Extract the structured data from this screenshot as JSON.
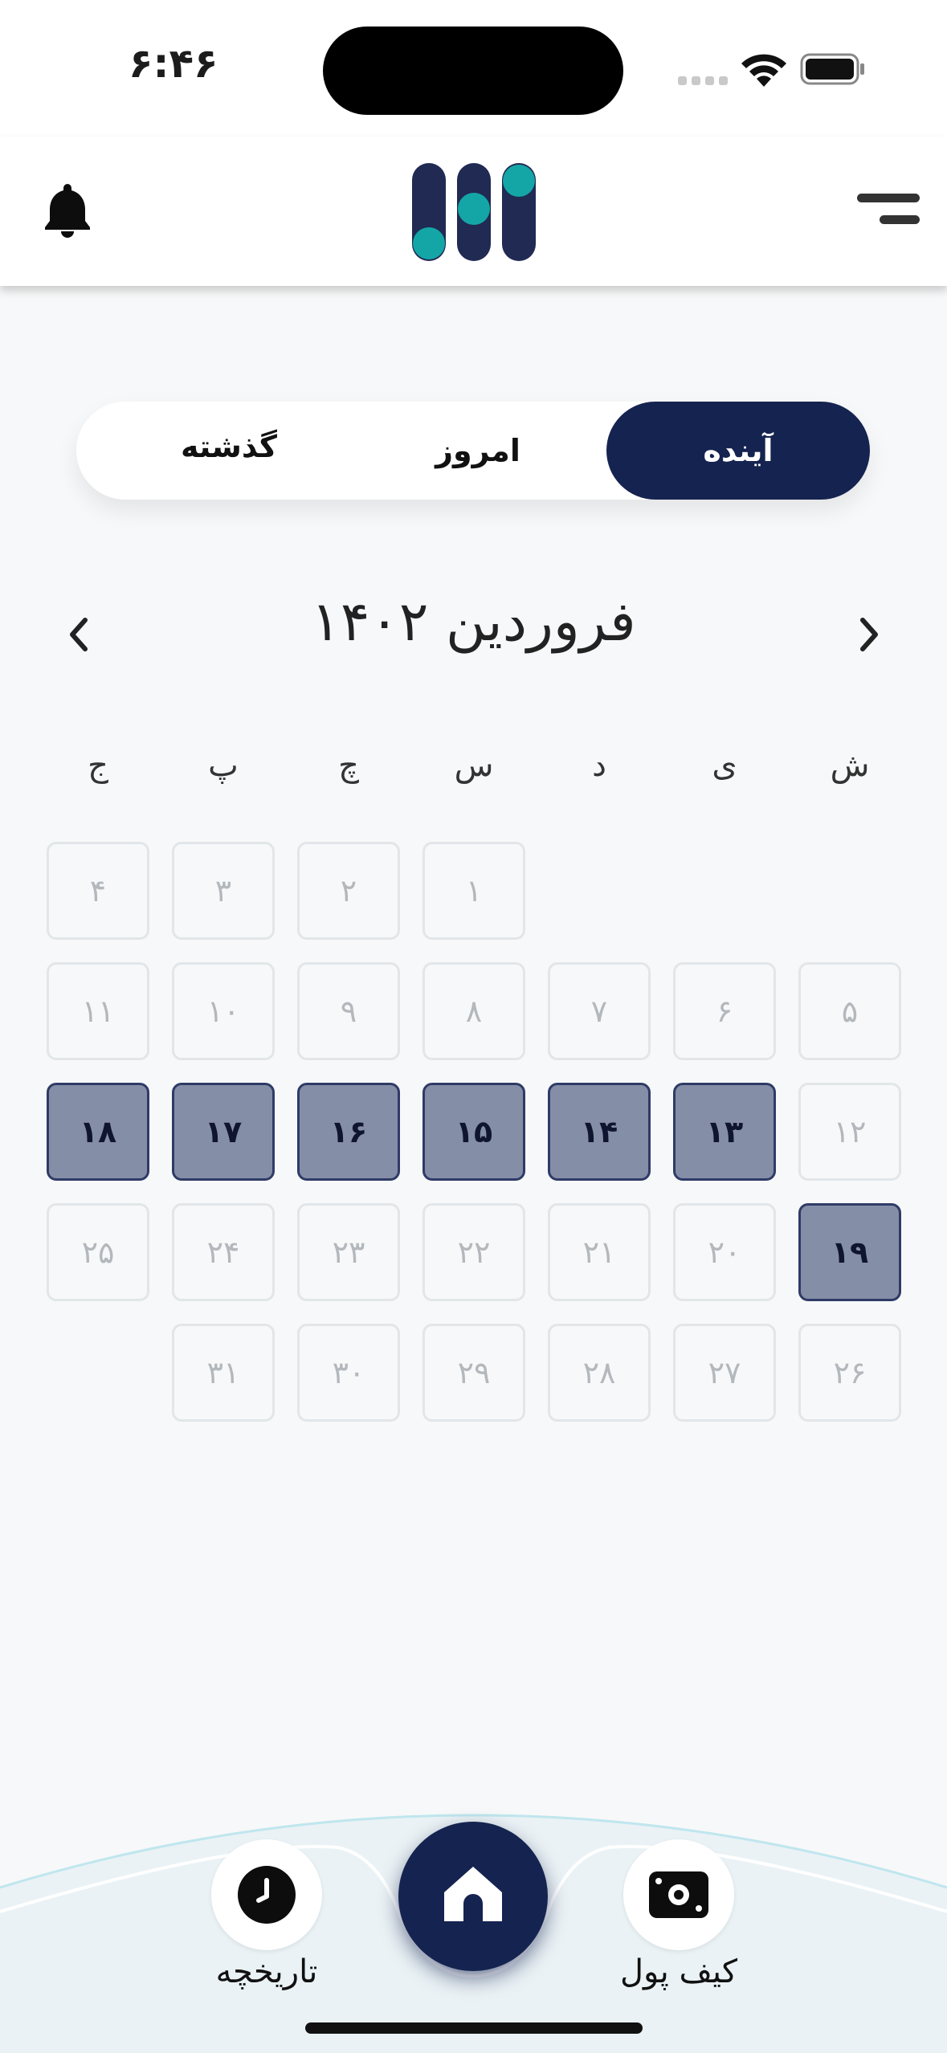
{
  "status_bar": {
    "time": "۶:۴۶"
  },
  "header": {
    "menu_icon": "menu-icon",
    "logo_icon": "app-logo",
    "notification_icon": "bell-icon"
  },
  "tabs": {
    "past": "گذشته",
    "today": "امروز",
    "future": "آینده",
    "selected": "future"
  },
  "calendar": {
    "month_title": "فروردین ۱۴۰۲",
    "weekdays": [
      "ش",
      "ی",
      "د",
      "س",
      "چ",
      "پ",
      "ج"
    ],
    "days": [
      "۱",
      "۲",
      "۳",
      "۴",
      "۵",
      "۶",
      "۷",
      "۸",
      "۹",
      "۱۰",
      "۱۱",
      "۱۲",
      "۱۳",
      "۱۴",
      "۱۵",
      "۱۶",
      "۱۷",
      "۱۸",
      "۱۹",
      "۲۰",
      "۲۱",
      "۲۲",
      "۲۳",
      "۲۴",
      "۲۵",
      "۲۶",
      "۲۷",
      "۲۸",
      "۲۹",
      "۳۰",
      "۳۱"
    ],
    "selected_days": [
      13,
      14,
      15,
      16,
      17,
      18,
      19
    ]
  },
  "bottom_nav": {
    "history_label": "تاریخچه",
    "wallet_label": "کیف پول",
    "home_icon": "home-icon"
  },
  "colors": {
    "primary": "#152350",
    "accent": "#14a6a6",
    "selected_cell": "#858ea7"
  }
}
